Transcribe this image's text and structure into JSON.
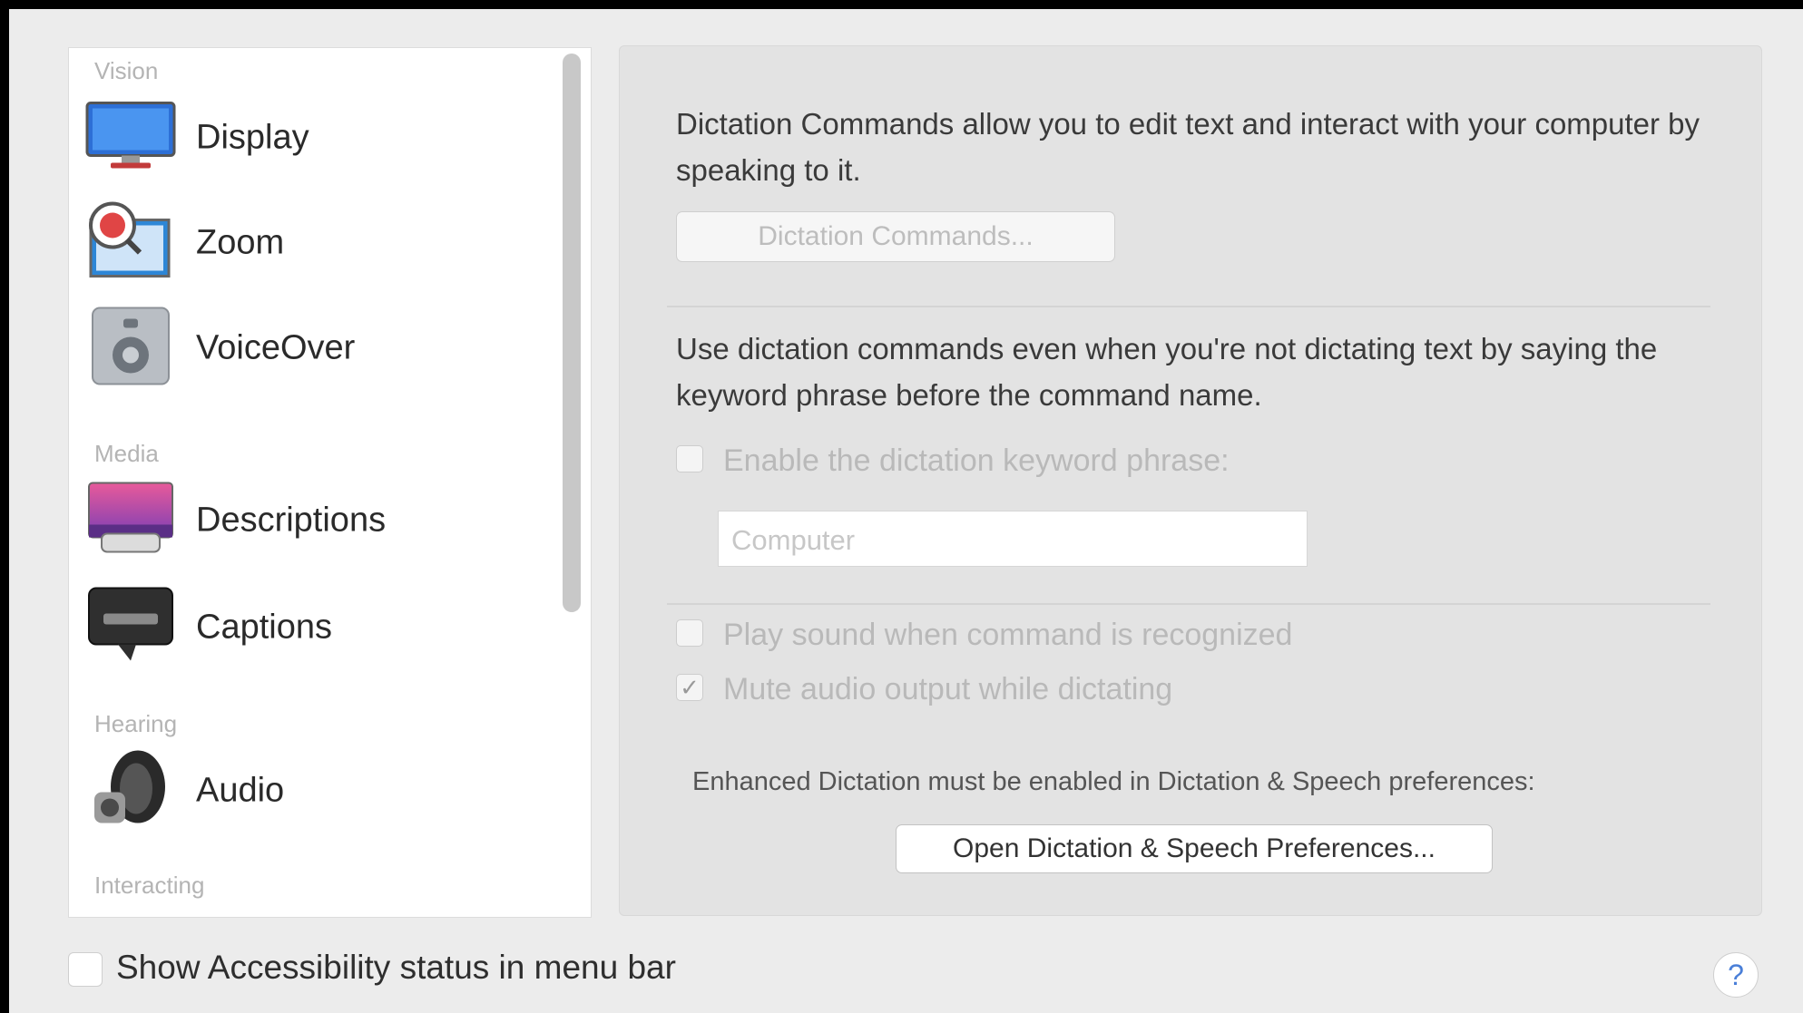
{
  "sidebar": {
    "sections": [
      {
        "header": "Vision"
      },
      {
        "header": "Media"
      },
      {
        "header": "Hearing"
      },
      {
        "header": "Interacting"
      }
    ],
    "items": [
      {
        "label": "Display",
        "icon": "display-icon"
      },
      {
        "label": "Zoom",
        "icon": "zoom-icon"
      },
      {
        "label": "VoiceOver",
        "icon": "voiceover-icon"
      },
      {
        "label": "Descriptions",
        "icon": "descriptions-icon"
      },
      {
        "label": "Captions",
        "icon": "captions-icon"
      },
      {
        "label": "Audio",
        "icon": "audio-icon"
      }
    ]
  },
  "panel": {
    "intro": "Dictation Commands allow you to edit text and interact with your computer by speaking to it.",
    "dictation_commands_button": "Dictation Commands...",
    "keyword_text": "Use dictation commands even when you're not dictating text by saying the keyword phrase before the command name.",
    "enable_keyword_label": "Enable the dictation keyword phrase:",
    "enable_keyword_checked": false,
    "keyword_field_value": "Computer",
    "play_sound_label": "Play sound when command is recognized",
    "play_sound_checked": false,
    "mute_audio_label": "Mute audio output while dictating",
    "mute_audio_checked": true,
    "enhanced_note": "Enhanced Dictation must be enabled in Dictation & Speech preferences:",
    "open_prefs_button": "Open Dictation & Speech Preferences..."
  },
  "footer": {
    "show_status_label": "Show Accessibility status in menu bar",
    "show_status_checked": false,
    "help_glyph": "?"
  },
  "colors": {
    "window_bg": "#ececec",
    "panel_bg": "#e3e3e3",
    "help_accent": "#4a7fd8"
  }
}
